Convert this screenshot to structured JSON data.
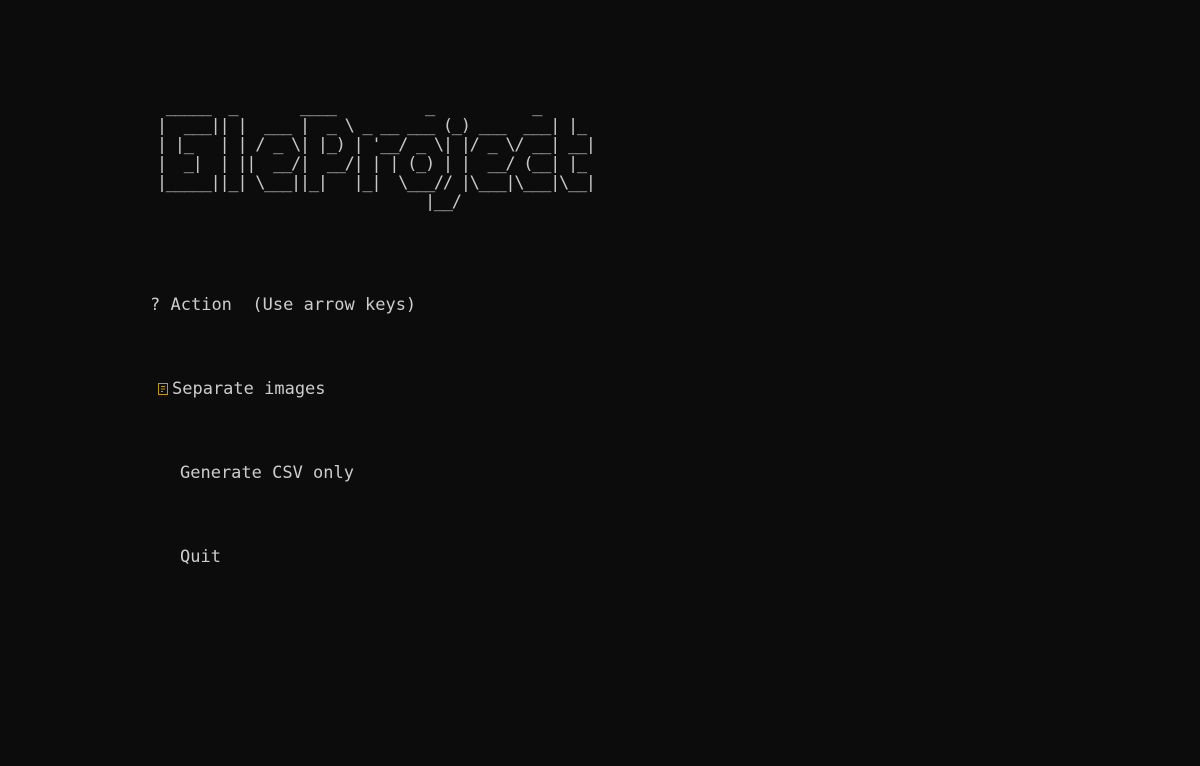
{
  "banner": {
    "ascii_lines": [
      "  _____  _       ____          _           _   ",
      " |  ___|| |  ___ |  _ \\ _ __ ___ (_) ___  ___| |_ ",
      " | |_   | | / _ \\| |_) | '__/ _ \\| |/ _ \\/ __| __|",
      " |  _|  | ||  __/|  __/| | | (_) | |  __/ (__| |_ ",
      " |_____||_| \\___||_|   |_|  \\___// |\\___|\\___|\\__|",
      "                               |__/              "
    ]
  },
  "prompt": {
    "qmark": "?",
    "question": "Action",
    "hint": "(Use arrow keys)",
    "choices": [
      "Separate images",
      "Generate CSV only",
      "Quit"
    ],
    "selected_index": 0,
    "pointer_icon": "pointer-icon",
    "pointer_color": "#c19c00"
  },
  "colors": {
    "background": "#0c0c0c",
    "foreground": "#cccccc"
  }
}
